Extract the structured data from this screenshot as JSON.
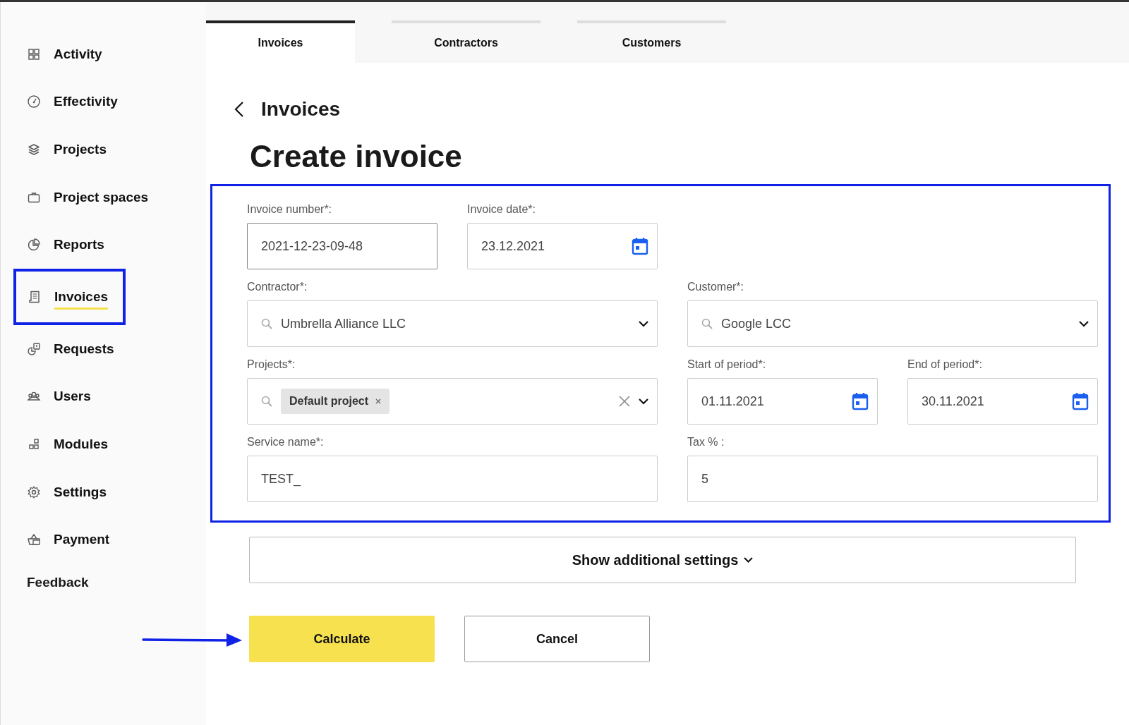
{
  "sidebar": {
    "items": [
      {
        "label": "Activity",
        "selected": false
      },
      {
        "label": "Effectivity",
        "selected": false
      },
      {
        "label": "Projects",
        "selected": false
      },
      {
        "label": "Project spaces",
        "selected": false
      },
      {
        "label": "Reports",
        "selected": false
      },
      {
        "label": "Invoices",
        "selected": true
      },
      {
        "label": "Requests",
        "selected": false
      },
      {
        "label": "Users",
        "selected": false
      },
      {
        "label": "Modules",
        "selected": false
      },
      {
        "label": "Settings",
        "selected": false
      },
      {
        "label": "Payment",
        "selected": false
      }
    ],
    "footer_link": "Feedback"
  },
  "tabs": [
    {
      "label": "Invoices",
      "selected": true
    },
    {
      "label": "Contractors",
      "selected": false
    },
    {
      "label": "Customers",
      "selected": false
    }
  ],
  "breadcrumb": "Invoices",
  "title": "Create invoice",
  "form": {
    "fields": [
      {
        "kind": "text",
        "label": "Invoice number*:",
        "value": "2021-12-23-09-48"
      },
      {
        "kind": "date",
        "label": "Invoice date*:",
        "value": "23.12.2021"
      },
      {
        "kind": "select",
        "label": "Contractor*:",
        "value": "Umbrella Alliance LLC"
      },
      {
        "kind": "select",
        "label": "Customer*:",
        "value": "Google LCC"
      },
      {
        "kind": "multiselect",
        "label": "Projects*:",
        "tags": [
          "Default project"
        ]
      },
      {
        "kind": "date",
        "label": "Start of period*:",
        "value": "01.11.2021"
      },
      {
        "kind": "date",
        "label": "End of period*:",
        "value": "30.11.2021"
      },
      {
        "kind": "text",
        "label": "Service name*:",
        "value": "TEST_"
      },
      {
        "kind": "text",
        "label": "Tax % :",
        "value": "5"
      }
    ]
  },
  "additional_settings": "Show additional settings",
  "buttons": [
    {
      "kind": "primary",
      "label": "Calculate"
    },
    {
      "kind": "secondary",
      "label": "Cancel"
    }
  ]
}
